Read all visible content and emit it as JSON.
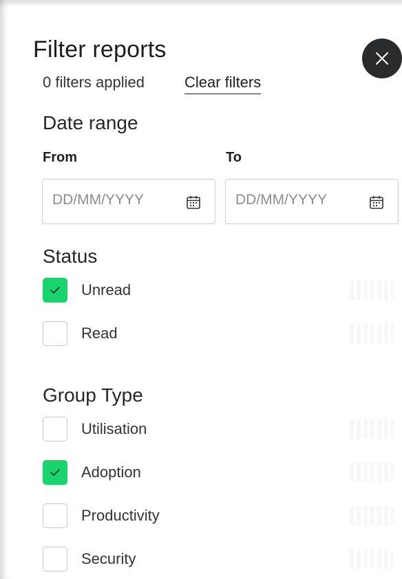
{
  "panel": {
    "title": "Filter reports",
    "filters_applied": "0 filters applied",
    "clear_label": "Clear filters"
  },
  "date_range": {
    "title": "Date range",
    "from_label": "From",
    "to_label": "To",
    "from_placeholder": "DD/MM/YYYY",
    "to_placeholder": "DD/MM/YYYY",
    "from_value": "",
    "to_value": ""
  },
  "status": {
    "title": "Status",
    "options": [
      {
        "label": "Unread",
        "checked": true
      },
      {
        "label": "Read",
        "checked": false
      }
    ]
  },
  "group_type": {
    "title": "Group Type",
    "options": [
      {
        "label": "Utilisation",
        "checked": false
      },
      {
        "label": "Adoption",
        "checked": true
      },
      {
        "label": "Productivity",
        "checked": false
      },
      {
        "label": "Security",
        "checked": false
      }
    ]
  },
  "icons": {
    "close": "close-icon",
    "calendar": "calendar-icon",
    "check": "checkmark-icon"
  },
  "colors": {
    "accent_green": "#19d46c",
    "close_button_bg": "#2a2b2d",
    "text_primary": "#1d1d1d"
  }
}
